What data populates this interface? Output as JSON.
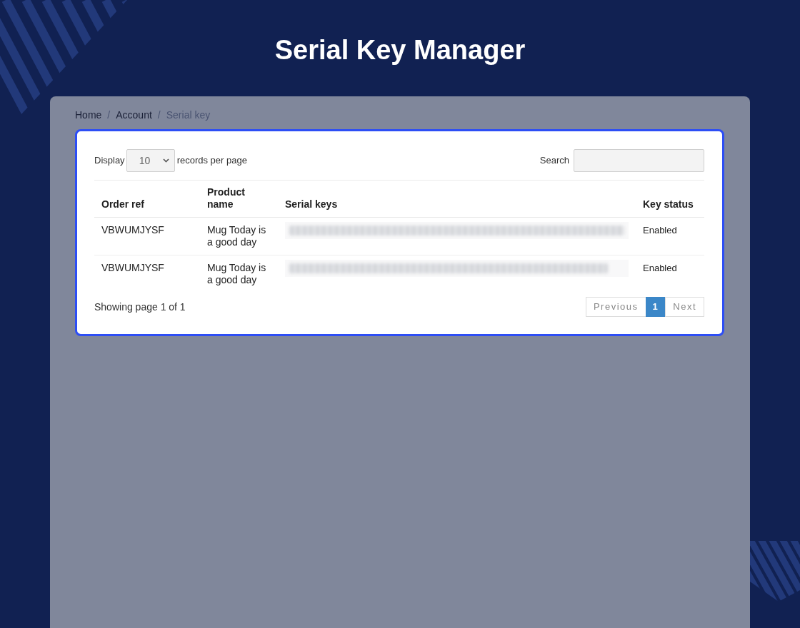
{
  "title": "Serial Key Manager",
  "breadcrumb": {
    "items": [
      {
        "label": "Home",
        "current": false
      },
      {
        "label": "Account",
        "current": false
      },
      {
        "label": "Serial key",
        "current": true
      }
    ],
    "separators": [
      "/",
      "/"
    ]
  },
  "toolbar": {
    "display_label": "Display",
    "page_size": "10",
    "per_page_label": "records per page",
    "search_label": "Search"
  },
  "table": {
    "columns": [
      "Order ref",
      "Product name",
      "Serial keys",
      "Key status"
    ],
    "rows": [
      {
        "order_ref": "VBWUMJYSF",
        "product_name": "Mug Today is a good day",
        "serial_key_blurred": true,
        "key_status": "Enabled"
      },
      {
        "order_ref": "VBWUMJYSF",
        "product_name": "Mug Today is a good day",
        "serial_key_blurred": true,
        "key_status": "Enabled"
      }
    ]
  },
  "footer": {
    "summary": "Showing page 1 of 1",
    "previous": "Previous",
    "pages": [
      {
        "label": "1",
        "selected": true
      }
    ],
    "next": "Next"
  }
}
